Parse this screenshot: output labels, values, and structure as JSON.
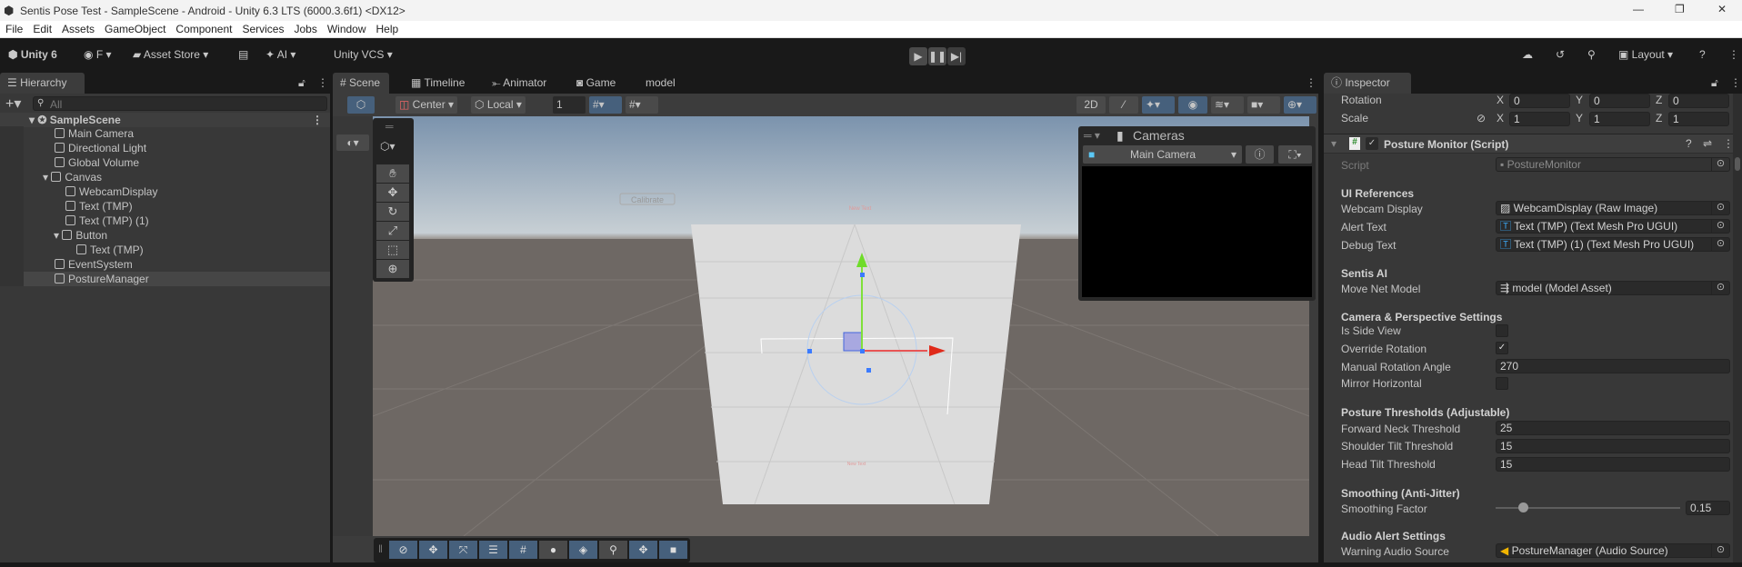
{
  "window": {
    "title": "Sentis Pose Test - SampleScene - Android - Unity 6.3 LTS (6000.3.6f1) <DX12>",
    "controls": [
      "—",
      "❐",
      "✕"
    ]
  },
  "menu": [
    "File",
    "Edit",
    "Assets",
    "GameObject",
    "Component",
    "Services",
    "Jobs",
    "Window",
    "Help"
  ],
  "toolbar": {
    "unity": "Unity 6",
    "account": "F",
    "asset_store": "Asset Store",
    "ai": "AI",
    "vcs": "Unity VCS",
    "layout": "Layout"
  },
  "tabs": {
    "hierarchy": "Hierarchy",
    "scene": "Scene",
    "timeline": "Timeline",
    "animator": "Animator",
    "game": "Game",
    "model": "model",
    "inspector": "Inspector"
  },
  "hierarchy": {
    "search_placeholder": "All",
    "scene": "SampleScene",
    "items": [
      {
        "label": "Main Camera"
      },
      {
        "label": "Directional Light"
      },
      {
        "label": "Global Volume"
      },
      {
        "label": "Canvas"
      },
      {
        "label": "WebcamDisplay"
      },
      {
        "label": "Text (TMP)"
      },
      {
        "label": "Text (TMP) (1)"
      },
      {
        "label": "Button"
      },
      {
        "label": "Text (TMP)"
      },
      {
        "label": "EventSystem"
      },
      {
        "label": "PostureManager"
      }
    ]
  },
  "scene": {
    "pivot": "Center",
    "space": "Local",
    "grid_value": "1",
    "cameras_title": "Cameras",
    "camera_select": "Main Camera",
    "calibrate": "Calibrate",
    "text1": "New Text",
    "text2": "New Text"
  },
  "inspector": {
    "rotation": {
      "label": "Rotation",
      "x": "0",
      "y": "0",
      "z": "0"
    },
    "scale": {
      "label": "Scale",
      "x": "1",
      "y": "1",
      "z": "1"
    },
    "axes": [
      "X",
      "Y",
      "Z"
    ],
    "component": "Posture Monitor (Script)",
    "script": {
      "label": "Script",
      "value": "PostureMonitor"
    },
    "ui_refs": "UI References",
    "webcam": {
      "label": "Webcam Display",
      "value": "WebcamDisplay (Raw Image)"
    },
    "alert": {
      "label": "Alert Text",
      "value": "Text (TMP) (Text Mesh Pro UGUI)"
    },
    "debug": {
      "label": "Debug Text",
      "value": "Text (TMP) (1) (Text Mesh Pro UGUI)"
    },
    "sentis": "Sentis AI",
    "model": {
      "label": "Move Net Model",
      "value": "model (Model Asset)"
    },
    "camera_settings": "Camera & Perspective Settings",
    "side_view": {
      "label": "Is Side View",
      "checked": false
    },
    "override": {
      "label": "Override Rotation",
      "checked": true,
      "mark": "✓"
    },
    "manual_angle": {
      "label": "Manual Rotation Angle",
      "value": "270"
    },
    "mirror": {
      "label": "Mirror Horizontal",
      "checked": false
    },
    "thresholds": "Posture Thresholds (Adjustable)",
    "neck": {
      "label": "Forward Neck Threshold",
      "value": "25"
    },
    "shoulder": {
      "label": "Shoulder Tilt Threshold",
      "value": "15"
    },
    "head": {
      "label": "Head Tilt Threshold",
      "value": "15"
    },
    "smoothing": "Smoothing (Anti-Jitter)",
    "smoothing_factor": {
      "label": "Smoothing Factor",
      "value": "0.15",
      "fraction": 0.15
    },
    "audio": "Audio Alert Settings",
    "warning_audio": {
      "label": "Warning Audio Source",
      "value": "PostureManager (Audio Source)"
    }
  }
}
